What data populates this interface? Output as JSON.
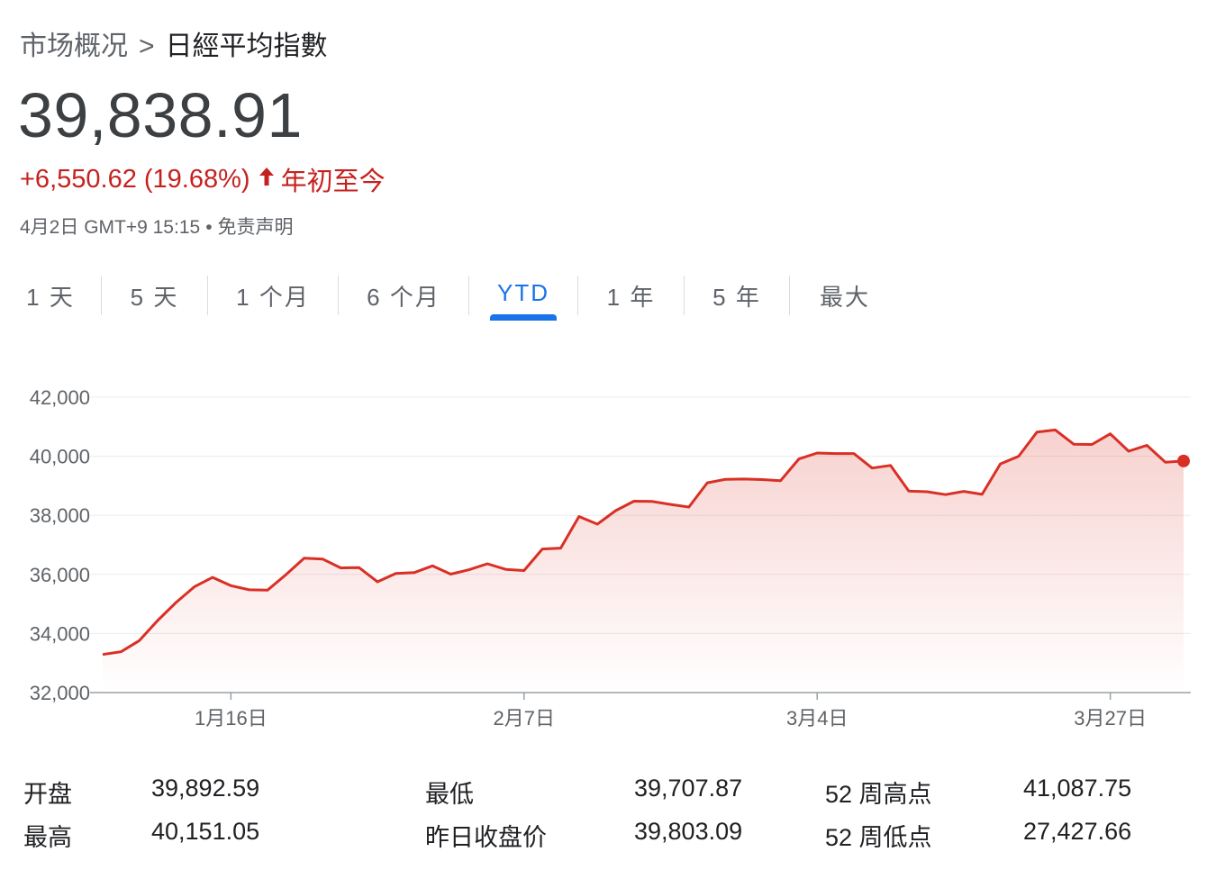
{
  "breadcrumb": {
    "parent": "市场概况",
    "separator": ">",
    "current": "日經平均指數"
  },
  "price": "39,838.91",
  "change": {
    "text": "+6,550.62 (19.68%)",
    "period": "年初至今",
    "color": "#c5221f",
    "direction_icon": "arrow-up-icon"
  },
  "timestamp": {
    "text": "4月2日 GMT+9 15:15",
    "dot": "•",
    "disclaimer": "免责声明"
  },
  "tabs": [
    {
      "label": "1 天",
      "selected": false
    },
    {
      "label": "5 天",
      "selected": false
    },
    {
      "label": "1 个月",
      "selected": false
    },
    {
      "label": "6 个月",
      "selected": false
    },
    {
      "label": "YTD",
      "selected": true
    },
    {
      "label": "1 年",
      "selected": false
    },
    {
      "label": "5 年",
      "selected": false
    },
    {
      "label": "最大",
      "selected": false
    }
  ],
  "chart_data": {
    "type": "area",
    "ylim": [
      32000,
      42000
    ],
    "yticks": [
      32000,
      34000,
      36000,
      38000,
      40000,
      42000
    ],
    "ytick_labels": [
      "32,000",
      "34,000",
      "36,000",
      "38,000",
      "40,000",
      "42,000"
    ],
    "xticks": [
      {
        "label": "1月16日",
        "index": 7
      },
      {
        "label": "2月7日",
        "index": 23
      },
      {
        "label": "3月4日",
        "index": 39
      },
      {
        "label": "3月27日",
        "index": 55
      }
    ],
    "values": [
      33290,
      33380,
      33760,
      34440,
      35050,
      35580,
      35900,
      35620,
      35480,
      35470,
      35990,
      36550,
      36520,
      36220,
      36230,
      35750,
      36030,
      36060,
      36290,
      36010,
      36160,
      36360,
      36170,
      36130,
      36860,
      36890,
      37960,
      37700,
      38160,
      38480,
      38470,
      38370,
      38280,
      39100,
      39220,
      39230,
      39210,
      39170,
      39910,
      40110,
      40090,
      40090,
      39600,
      39690,
      38820,
      38800,
      38700,
      38810,
      38710,
      39740,
      40000,
      40820,
      40890,
      40410,
      40400,
      40760,
      40170,
      40370,
      39800,
      39838.91
    ],
    "line_color": "#d93025",
    "grid": true
  },
  "stats": {
    "col1": [
      {
        "label": "开盘",
        "value": "39,892.59"
      },
      {
        "label": "最高",
        "value": "40,151.05"
      }
    ],
    "col2": [
      {
        "label": "最低",
        "value": "39,707.87"
      },
      {
        "label": "昨日收盘价",
        "value": "39,803.09"
      }
    ],
    "col3": [
      {
        "label": "52 周高点",
        "value": "41,087.75"
      },
      {
        "label": "52 周低点",
        "value": "27,427.66"
      }
    ]
  }
}
